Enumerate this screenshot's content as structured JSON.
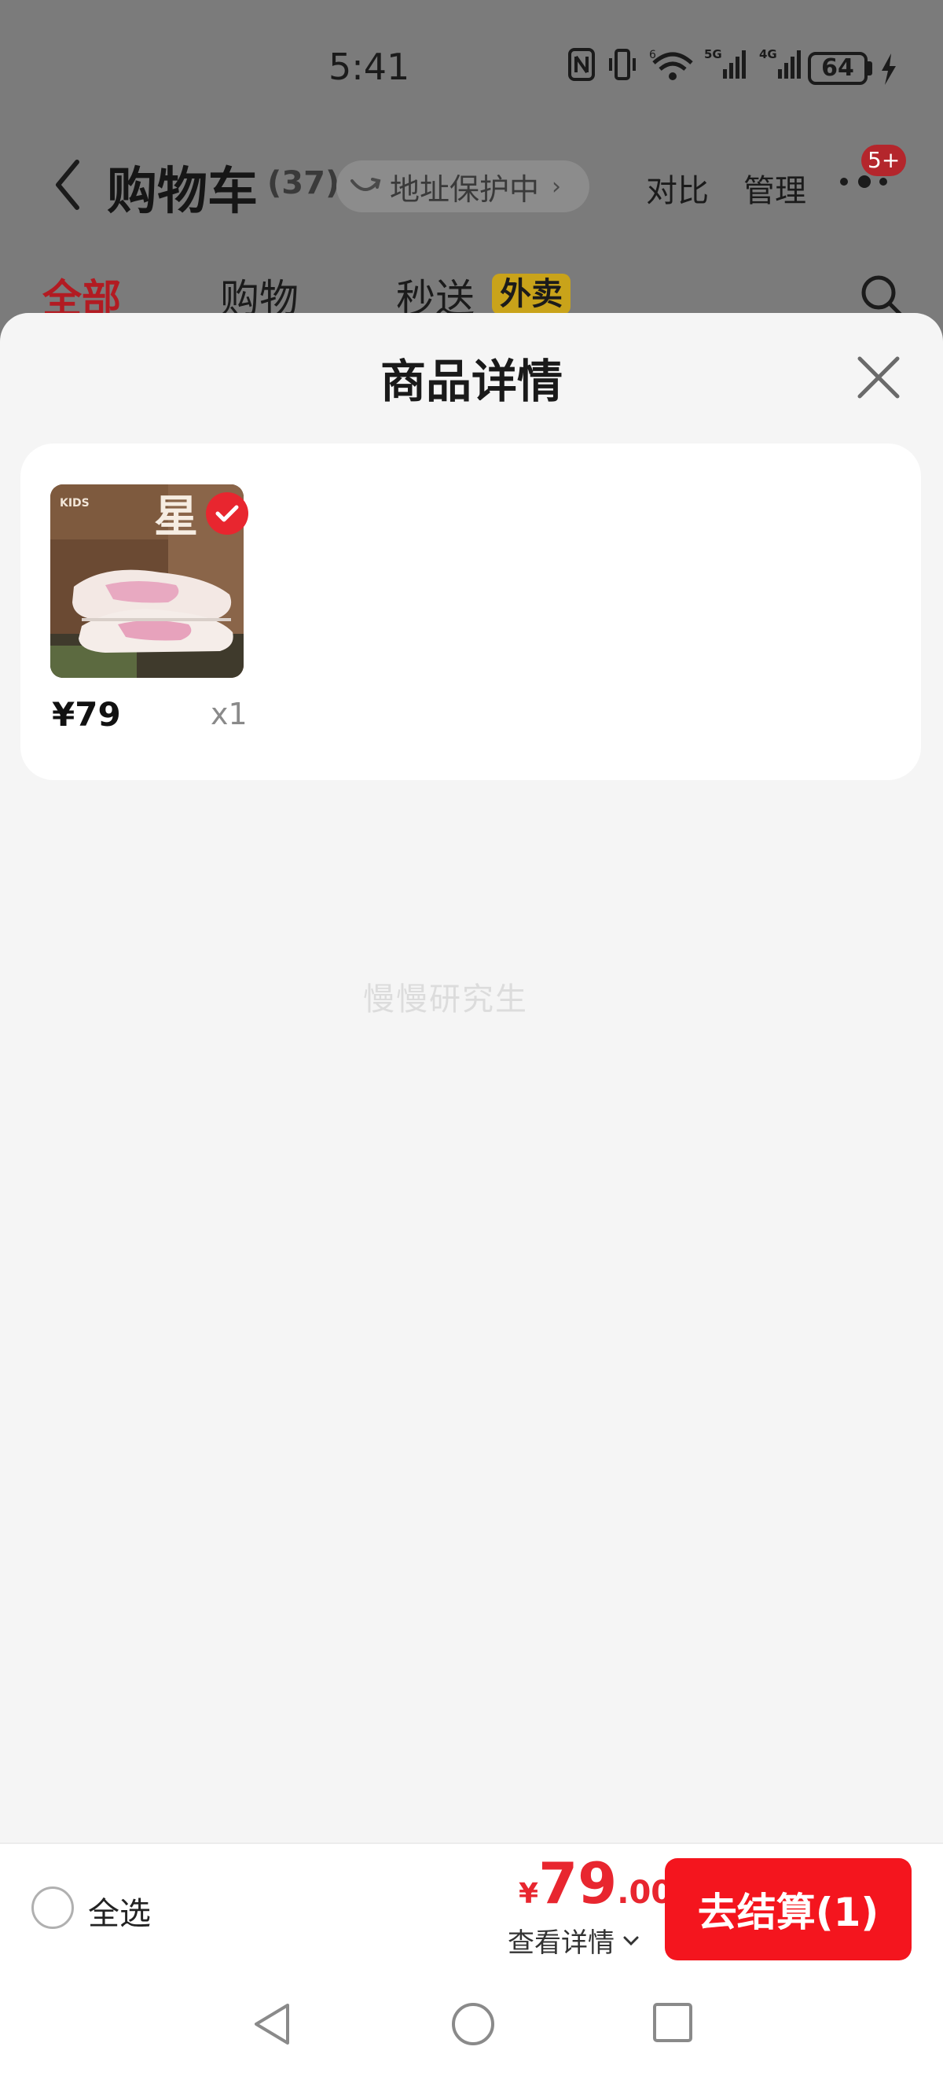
{
  "status_bar": {
    "time": "5:41",
    "battery_level": "64",
    "icons": [
      "nfc-icon",
      "vibrate-icon",
      "wifi-icon",
      "5g-signal-icon",
      "4g-signal-icon",
      "battery-icon",
      "charging-icon"
    ],
    "network_labels": {
      "wifi": "6",
      "cell1": "5G",
      "cell2": "4G"
    }
  },
  "header": {
    "title": "购物车",
    "count": "(37)",
    "address_pill": "地址保护中",
    "compare": "对比",
    "manage": "管理",
    "badge": "5+"
  },
  "tabs": [
    {
      "label": "全部",
      "active": true
    },
    {
      "label": "购物",
      "active": false
    },
    {
      "label": "秒送",
      "active": false,
      "badge": "外卖"
    }
  ],
  "sheet": {
    "title": "商品详情",
    "items": [
      {
        "price": "¥79",
        "quantity": "x1",
        "selected": true,
        "thumb_brand_text": "KIDS",
        "thumb_title_text": "星"
      }
    ],
    "watermark": "慢慢研究生"
  },
  "checkout": {
    "select_all_label": "全选",
    "currency": "¥",
    "total_int": "79",
    "total_dec": ".00",
    "view_details": "查看详情",
    "button_label": "去结算(1)"
  },
  "colors": {
    "accent_red": "#f4151e",
    "price_red": "#e8262f",
    "overlay_grey": "#7b7b7b",
    "sheet_bg": "#f5f5f5"
  }
}
